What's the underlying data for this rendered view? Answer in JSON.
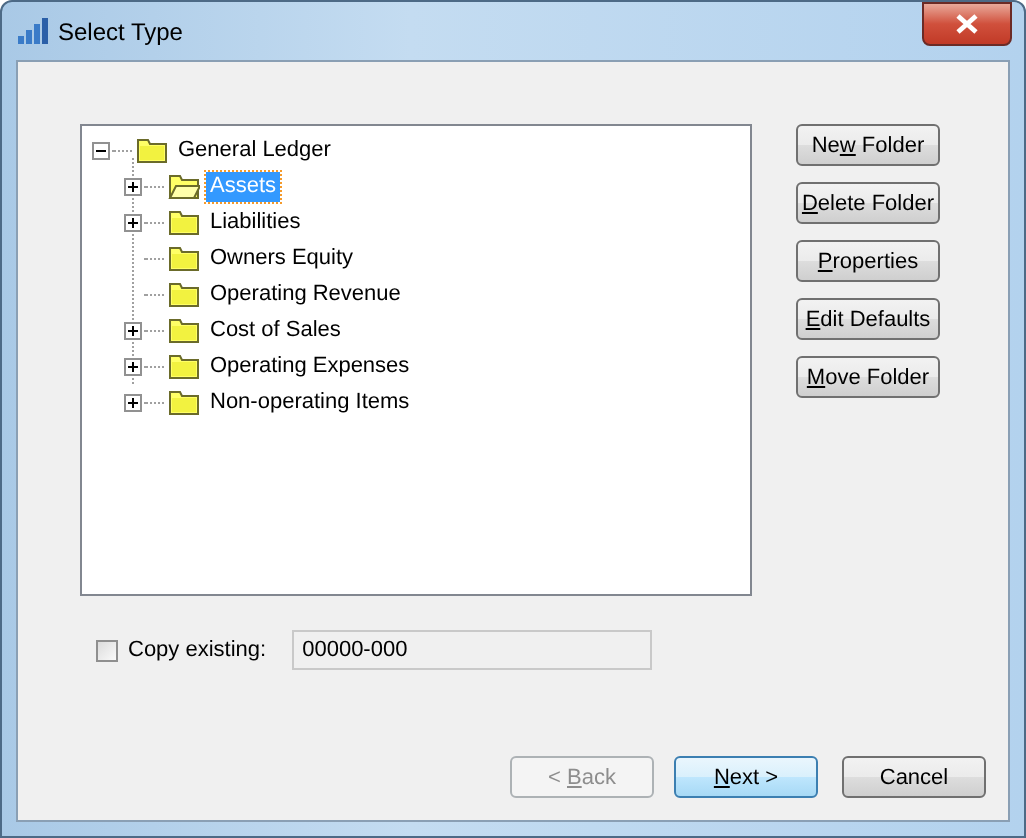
{
  "window": {
    "title": "Select Type"
  },
  "tree": {
    "label": "General Ledger",
    "expanded": true,
    "children": [
      {
        "label": "Assets",
        "selected": true,
        "has_children": true
      },
      {
        "label": "Liabilities",
        "selected": false,
        "has_children": true
      },
      {
        "label": "Owners Equity",
        "selected": false,
        "has_children": false
      },
      {
        "label": "Operating Revenue",
        "selected": false,
        "has_children": false
      },
      {
        "label": "Cost of Sales",
        "selected": false,
        "has_children": true
      },
      {
        "label": "Operating Expenses",
        "selected": false,
        "has_children": true
      },
      {
        "label": "Non-operating Items",
        "selected": false,
        "has_children": true
      }
    ]
  },
  "side_buttons": [
    {
      "before": "Ne",
      "key": "w",
      "after": " Folder"
    },
    {
      "key": "D",
      "after": "elete Folder"
    },
    {
      "key": "P",
      "after": "roperties"
    },
    {
      "key": "E",
      "after": "dit Defaults"
    },
    {
      "key": "M",
      "after": "ove Folder"
    }
  ],
  "copy_existing": {
    "label": "Copy existing:",
    "checked": false,
    "value": "00000-000"
  },
  "footer_buttons": [
    {
      "before": "< ",
      "key": "B",
      "after": "ack",
      "disabled": true,
      "default": false
    },
    {
      "key": "N",
      "after": "ext >",
      "disabled": false,
      "default": true
    },
    {
      "before": "Cancel",
      "disabled": false,
      "default": false
    }
  ]
}
